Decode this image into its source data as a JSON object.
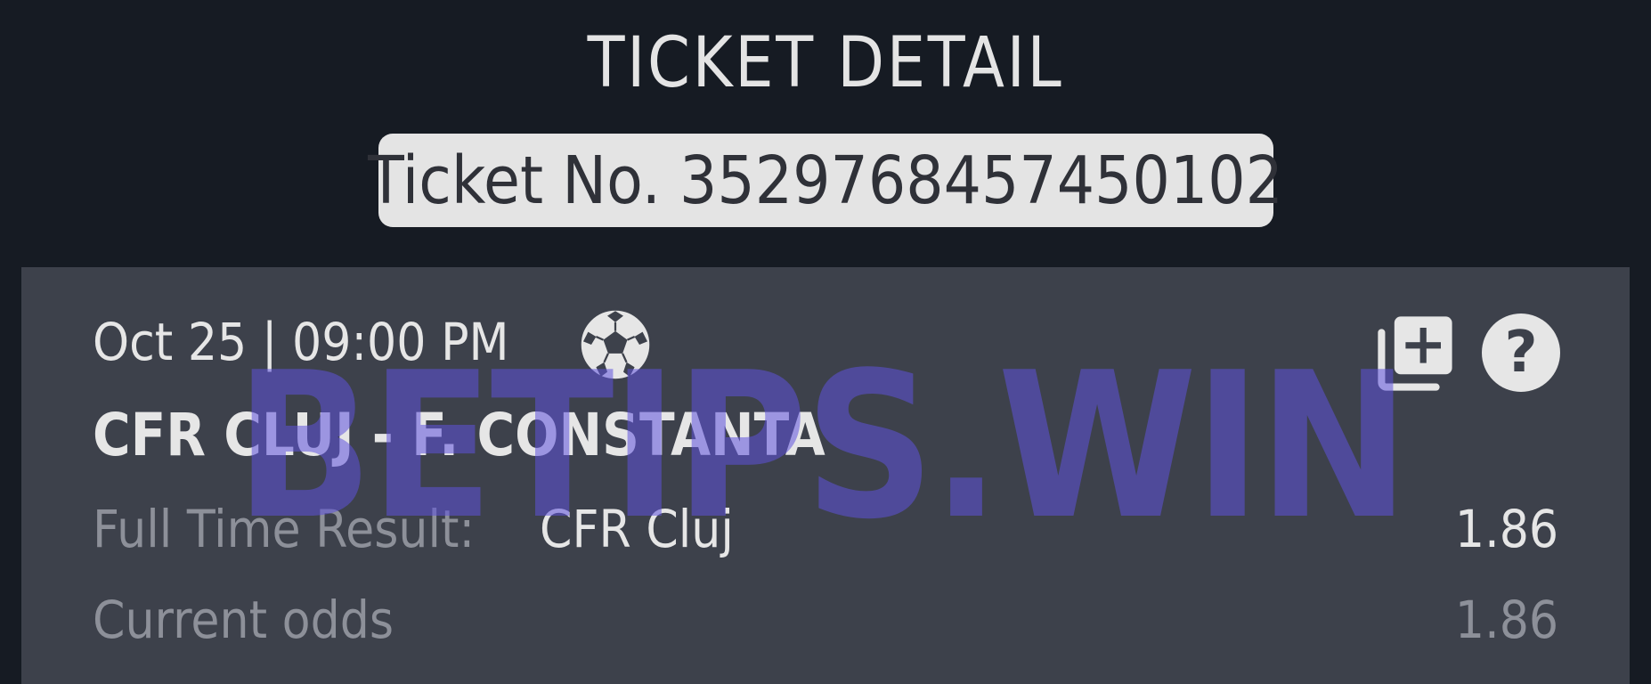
{
  "header": {
    "title": "TICKET DETAIL",
    "ticket_number": "Ticket No. 3529768457450102"
  },
  "event": {
    "datetime": "Oct 25 | 09:00 PM",
    "sport_icon": "soccer-ball-icon",
    "match": "CFR CLUJ - F. CONSTANTA",
    "market_label": "Full Time Result:",
    "pick": "CFR Cluj",
    "odds": "1.86",
    "current_odds_label": "Current odds",
    "current_odds": "1.86"
  },
  "actions": {
    "add_icon": "library-add-icon",
    "help_icon": "help-icon",
    "help_glyph": "?"
  },
  "watermark": "BETIPS.WIN",
  "colors": {
    "background": "#161b23",
    "card": "#3d414b",
    "pill": "#e4e4e4",
    "text_primary": "#e6e6e6",
    "text_muted": "#8d9099",
    "watermark": "#5f52dc"
  }
}
